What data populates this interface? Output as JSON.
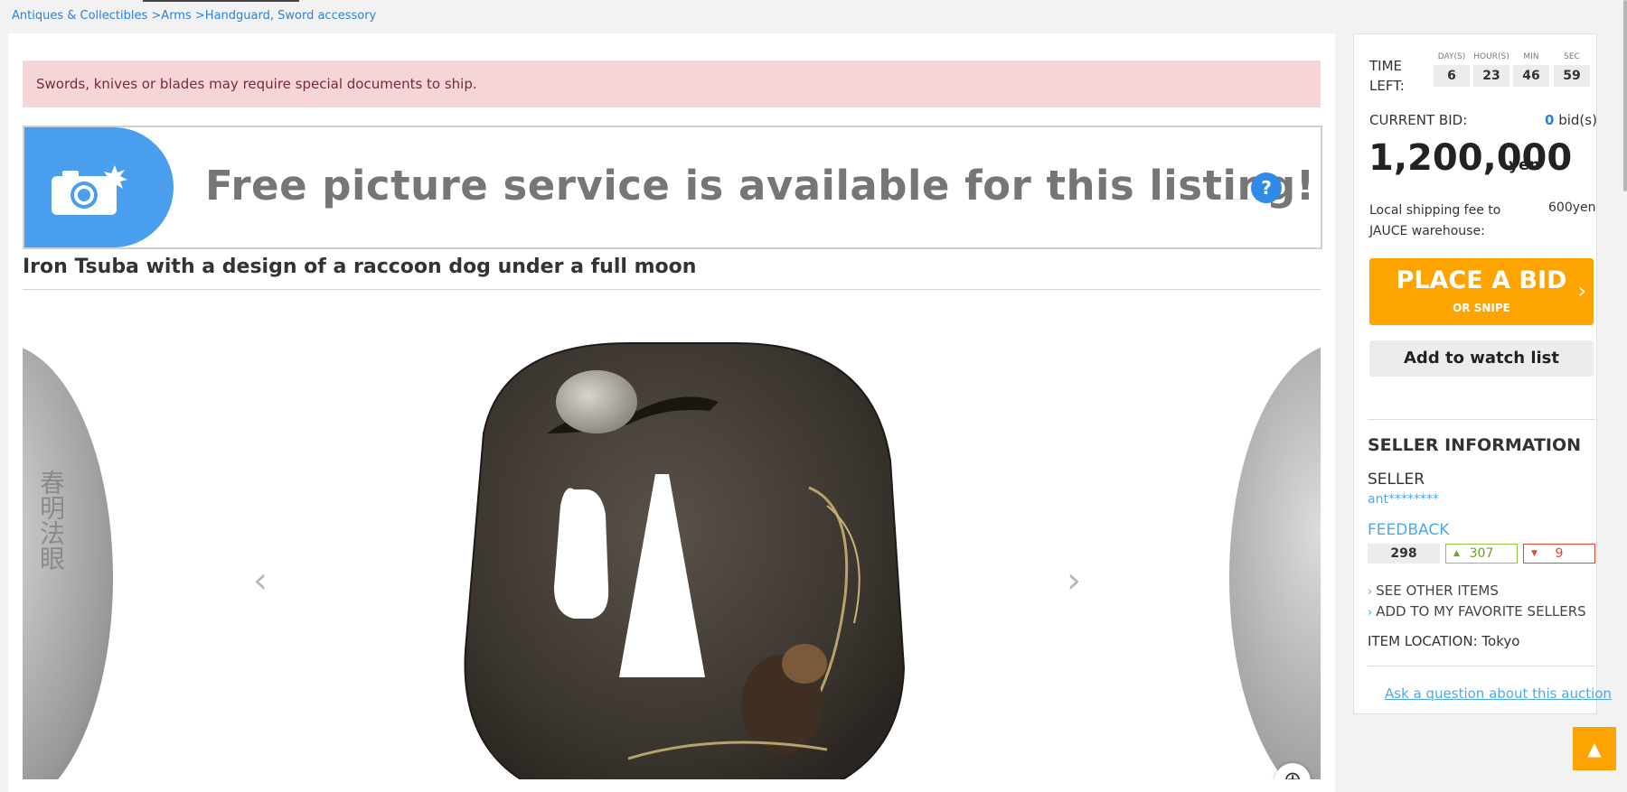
{
  "breadcrumb": {
    "items": [
      "Antiques & Collectibles",
      "Arms",
      "Handguard, Sword accessory"
    ],
    "separator": ">"
  },
  "alert": {
    "text": "Swords, knives or blades may require special documents to ship."
  },
  "banner": {
    "text": "Free picture service is available for this listing!",
    "help_symbol": "?"
  },
  "item": {
    "title": "Iron Tsuba with a design of a raccoon dog under a full moon"
  },
  "gallery": {
    "prev_symbol": "‹",
    "next_symbol": "›",
    "zoom_symbol": "⊕",
    "left_engraving": "春明法眼"
  },
  "timer": {
    "label": "TIME LEFT:",
    "cols": [
      {
        "label": "DAY(S)",
        "value": "6"
      },
      {
        "label": "HOUR(S)",
        "value": "23"
      },
      {
        "label": "MIN",
        "value": "46"
      },
      {
        "label": "SEC",
        "value": "59"
      }
    ]
  },
  "bid": {
    "current_label": "CURRENT BID:",
    "count": "0",
    "count_suffix": "bid(s)",
    "price": "1,200,000",
    "unit": "yen"
  },
  "shipping": {
    "label": "Local shipping fee to JAUCE warehouse:",
    "value": "600yen"
  },
  "buttons": {
    "place_bid": "PLACE A BID",
    "place_bid_sub": "OR SNIPE",
    "chevron": "›",
    "watch": "Add to watch list",
    "scroll_top": "▲"
  },
  "seller": {
    "heading": "SELLER INFORMATION",
    "label": "SELLER",
    "name": "ant********",
    "feedback_label": "FEEDBACK",
    "feedback_total": "298",
    "feedback_positive": "307",
    "feedback_negative": "9",
    "see_other": "SEE OTHER ITEMS",
    "add_favorite": "ADD TO MY FAVORITE SELLERS",
    "location": "ITEM LOCATION: Tokyo",
    "ask": "Ask a question about this auction"
  },
  "colors": {
    "accent": "#fea400",
    "link": "#2e82d8",
    "alert_bg": "#f6d5d8",
    "positive": "#8dc63f",
    "negative": "#e8452c"
  },
  "icons": [
    "camera-icon",
    "help-icon",
    "chevron-left-icon",
    "chevron-right-icon",
    "zoom-in-icon",
    "arrow-up-icon"
  ]
}
